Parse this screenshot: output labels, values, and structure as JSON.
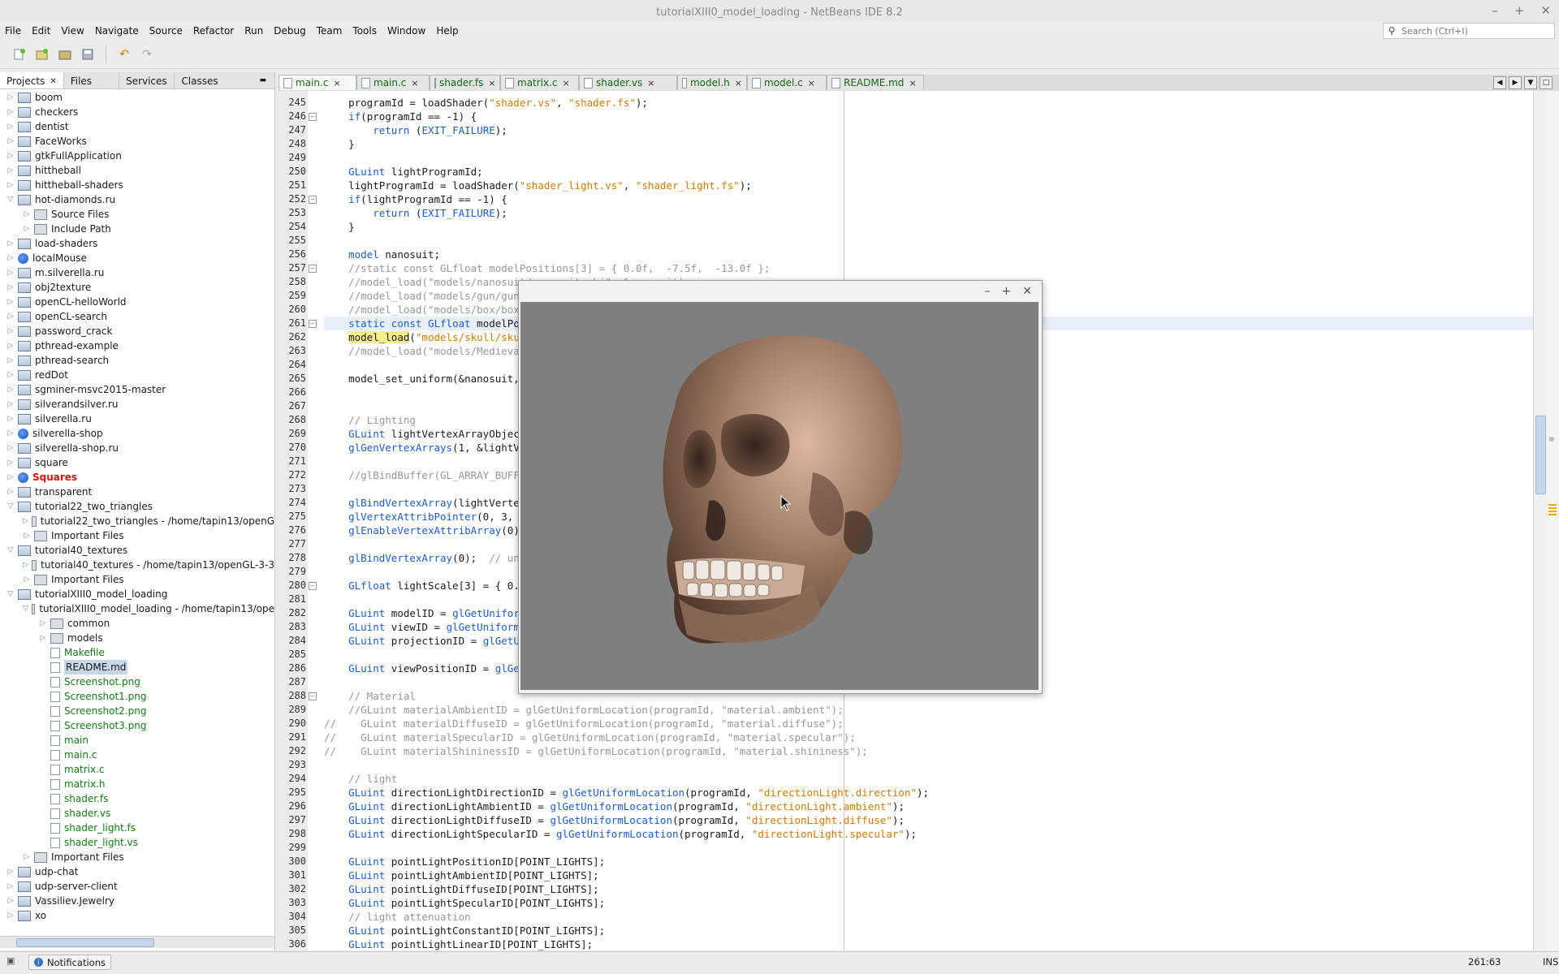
{
  "window": {
    "title": "tutorialXIII0_model_loading - NetBeans IDE 8.2"
  },
  "menu": [
    "File",
    "Edit",
    "View",
    "Navigate",
    "Source",
    "Refactor",
    "Run",
    "Debug",
    "Team",
    "Tools",
    "Window",
    "Help"
  ],
  "search": {
    "placeholder": "Search (Ctrl+I)"
  },
  "left_tabs": [
    "Projects",
    "Files",
    "Services",
    "Classes"
  ],
  "tree": [
    {
      "label": "boom",
      "level": 0,
      "icon": "proj",
      "exp": "+"
    },
    {
      "label": "checkers",
      "level": 0,
      "icon": "proj",
      "exp": "+"
    },
    {
      "label": "dentist",
      "level": 0,
      "icon": "proj",
      "exp": "+"
    },
    {
      "label": "FaceWorks",
      "level": 0,
      "icon": "proj",
      "exp": "+"
    },
    {
      "label": "gtkFullApplication",
      "level": 0,
      "icon": "proj",
      "exp": "+"
    },
    {
      "label": "hittheball",
      "level": 0,
      "icon": "proj",
      "exp": "+"
    },
    {
      "label": "hittheball-shaders",
      "level": 0,
      "icon": "proj",
      "exp": "+"
    },
    {
      "label": "hot-diamonds.ru",
      "level": 0,
      "icon": "proj",
      "exp": "-"
    },
    {
      "label": "Source Files",
      "level": 1,
      "icon": "folder",
      "exp": "+"
    },
    {
      "label": "Include Path",
      "level": 1,
      "icon": "folder",
      "exp": "+"
    },
    {
      "label": "load-shaders",
      "level": 0,
      "icon": "proj",
      "exp": "+"
    },
    {
      "label": "localMouse",
      "level": 0,
      "icon": "globe",
      "exp": "+"
    },
    {
      "label": "m.silverella.ru",
      "level": 0,
      "icon": "proj",
      "exp": "+"
    },
    {
      "label": "obj2texture",
      "level": 0,
      "icon": "proj",
      "exp": "+"
    },
    {
      "label": "openCL-helloWorld",
      "level": 0,
      "icon": "proj",
      "exp": "+"
    },
    {
      "label": "openCL-search",
      "level": 0,
      "icon": "proj",
      "exp": "+"
    },
    {
      "label": "password_crack",
      "level": 0,
      "icon": "proj",
      "exp": "+"
    },
    {
      "label": "pthread-example",
      "level": 0,
      "icon": "proj",
      "exp": "+"
    },
    {
      "label": "pthread-search",
      "level": 0,
      "icon": "proj",
      "exp": "+"
    },
    {
      "label": "redDot",
      "level": 0,
      "icon": "proj",
      "exp": "+"
    },
    {
      "label": "sgminer-msvc2015-master",
      "level": 0,
      "icon": "proj",
      "exp": "+"
    },
    {
      "label": "silverandsilver.ru",
      "level": 0,
      "icon": "proj",
      "exp": "+"
    },
    {
      "label": "silverella.ru",
      "level": 0,
      "icon": "proj",
      "exp": "+"
    },
    {
      "label": "silverella-shop",
      "level": 0,
      "icon": "globe",
      "exp": "+"
    },
    {
      "label": "silverella-shop.ru",
      "level": 0,
      "icon": "proj",
      "exp": "+"
    },
    {
      "label": "square",
      "level": 0,
      "icon": "proj",
      "exp": "+"
    },
    {
      "label": "Squares",
      "level": 0,
      "icon": "globe",
      "exp": "+",
      "style": "red"
    },
    {
      "label": "transparent",
      "level": 0,
      "icon": "proj",
      "exp": "+"
    },
    {
      "label": "tutorial22_two_triangles",
      "level": 0,
      "icon": "proj",
      "exp": "-"
    },
    {
      "label": "tutorial22_two_triangles - /home/tapin13/openG",
      "level": 1,
      "icon": "folder",
      "exp": "+"
    },
    {
      "label": "Important Files",
      "level": 1,
      "icon": "folder",
      "exp": "+"
    },
    {
      "label": "tutorial40_textures",
      "level": 0,
      "icon": "proj",
      "exp": "-"
    },
    {
      "label": "tutorial40_textures - /home/tapin13/openGL-3-3",
      "level": 1,
      "icon": "folder",
      "exp": "+"
    },
    {
      "label": "Important Files",
      "level": 1,
      "icon": "folder",
      "exp": "+"
    },
    {
      "label": "tutorialXIII0_model_loading",
      "level": 0,
      "icon": "proj",
      "exp": "-"
    },
    {
      "label": "tutorialXIII0_model_loading - /home/tapin13/ope",
      "level": 1,
      "icon": "folder",
      "exp": "-"
    },
    {
      "label": "common",
      "level": 2,
      "icon": "folder",
      "exp": "+"
    },
    {
      "label": "models",
      "level": 2,
      "icon": "folder",
      "exp": "+"
    },
    {
      "label": "Makefile",
      "level": 2,
      "icon": "file",
      "exp": "",
      "style": "green"
    },
    {
      "label": "README.md",
      "level": 2,
      "icon": "file",
      "exp": "",
      "style": "sel"
    },
    {
      "label": "Screenshot.png",
      "level": 2,
      "icon": "file",
      "exp": "",
      "style": "green"
    },
    {
      "label": "Screenshot1.png",
      "level": 2,
      "icon": "file",
      "exp": "",
      "style": "green"
    },
    {
      "label": "Screenshot2.png",
      "level": 2,
      "icon": "file",
      "exp": "",
      "style": "green"
    },
    {
      "label": "Screenshot3.png",
      "level": 2,
      "icon": "file",
      "exp": "",
      "style": "green"
    },
    {
      "label": "main",
      "level": 2,
      "icon": "file",
      "exp": "",
      "style": "green"
    },
    {
      "label": "main.c",
      "level": 2,
      "icon": "file",
      "exp": "",
      "style": "green"
    },
    {
      "label": "matrix.c",
      "level": 2,
      "icon": "file",
      "exp": "",
      "style": "green"
    },
    {
      "label": "matrix.h",
      "level": 2,
      "icon": "file",
      "exp": "",
      "style": "green"
    },
    {
      "label": "shader.fs",
      "level": 2,
      "icon": "file",
      "exp": "",
      "style": "green"
    },
    {
      "label": "shader.vs",
      "level": 2,
      "icon": "file",
      "exp": "",
      "style": "green"
    },
    {
      "label": "shader_light.fs",
      "level": 2,
      "icon": "file",
      "exp": "",
      "style": "green"
    },
    {
      "label": "shader_light.vs",
      "level": 2,
      "icon": "file",
      "exp": "",
      "style": "green"
    },
    {
      "label": "Important Files",
      "level": 1,
      "icon": "folder",
      "exp": "+"
    },
    {
      "label": "udp-chat",
      "level": 0,
      "icon": "proj",
      "exp": "+"
    },
    {
      "label": "udp-server-client",
      "level": 0,
      "icon": "proj",
      "exp": "+"
    },
    {
      "label": "Vassiliev.Jewelry",
      "level": 0,
      "icon": "proj",
      "exp": "+"
    },
    {
      "label": "xo",
      "level": 0,
      "icon": "proj",
      "exp": "+"
    }
  ],
  "editor_tabs": [
    "main.c",
    "main.c",
    "shader.fs",
    "matrix.c",
    "shader.vs",
    "model.h",
    "model.c",
    "README.md"
  ],
  "code": [
    {
      "n": "245",
      "h": "    programId = loadShader(<s>\"shader.vs\"</s>, <s>\"shader.fs\"</s>);"
    },
    {
      "n": "246",
      "f": "-",
      "h": "    <k>if</k>(programId == -1) {"
    },
    {
      "n": "247",
      "h": "        <k>return</k> (<c>EXIT_FAILURE</c>);"
    },
    {
      "n": "248",
      "h": "    }"
    },
    {
      "n": "249",
      "h": ""
    },
    {
      "n": "250",
      "h": "    <t>GLuint</t> lightProgramId;"
    },
    {
      "n": "251",
      "h": "    lightProgramId = loadShader(<s>\"shader_light.vs\"</s>, <s>\"shader_light.fs\"</s>);"
    },
    {
      "n": "252",
      "f": "-",
      "h": "    <k>if</k>(lightProgramId == -1) {"
    },
    {
      "n": "253",
      "h": "        <k>return</k> (<c>EXIT_FAILURE</c>);"
    },
    {
      "n": "254",
      "h": "    }"
    },
    {
      "n": "255",
      "h": ""
    },
    {
      "n": "256",
      "h": "    <t>model</t> nanosuit;"
    },
    {
      "n": "257",
      "f": "-",
      "h": "    <m>//static const GLfloat modelPositions[3] = { 0.0f,  -7.5f,  -13.0f };</m>"
    },
    {
      "n": "258",
      "h": "    <m>//model_load(\"models/nanosuit/nanosuit.obj\", &nanosuit);</m>"
    },
    {
      "n": "259",
      "h": "    <m>//model_load(\"models/gun/gun.obj\", &nanosuit);</m>"
    },
    {
      "n": "260",
      "h": "    <m>//model_load(\"models/box/box.obj\", &nanosuit);</m>"
    },
    {
      "n": "261",
      "f": "-",
      "hl": true,
      "h": "    <k>static</k> <k>const</k> <t>GLfloat</t> modelPositions[3] = { 0.0f,  -7.5f,  -13.0f };"
    },
    {
      "n": "262",
      "h": "    <y>model_load</y>(<s>\"models/skull/skull.obj\"</s>, &nanosuit);"
    },
    {
      "n": "263",
      "h": "    <m>//model_load(\"models/Medieval/Medieval.obj\", &nanosuit);</m>"
    },
    {
      "n": "264",
      "h": ""
    },
    {
      "n": "265",
      "h": "    model_set_uniform(&nanosuit, programId);"
    },
    {
      "n": "266",
      "h": ""
    },
    {
      "n": "267",
      "h": ""
    },
    {
      "n": "268",
      "h": "    <m>// Lighting</m>"
    },
    {
      "n": "269",
      "h": "    <t>GLuint</t> lightVertexArrayObject;"
    },
    {
      "n": "270",
      "h": "    <f>glGenVertexArrays</f>(1, &lightVertexArrayObject);"
    },
    {
      "n": "271",
      "h": ""
    },
    {
      "n": "272",
      "h": "    <m>//glBindBuffer(GL_ARRAY_BUFFER, vertexBufferObject);</m>"
    },
    {
      "n": "273",
      "h": ""
    },
    {
      "n": "274",
      "h": "    <f>glBindVertexArray</f>(lightVertexArrayObject);"
    },
    {
      "n": "275",
      "h": "    <f>glVertexAttribPointer</f>(0, 3, GL_FLOAT, GL_FALSE, 0, 0);"
    },
    {
      "n": "276",
      "h": "    <f>glEnableVertexAttribArray</f>(0);"
    },
    {
      "n": "277",
      "h": ""
    },
    {
      "n": "278",
      "h": "    <f>glBindVertexArray</f>(0);  <m>// unbind</m>"
    },
    {
      "n": "279",
      "h": ""
    },
    {
      "n": "280",
      "f": "-",
      "h": "    <t>GLfloat</t> lightScale[3] = { 0.2f, 0.2f, 0.2f };"
    },
    {
      "n": "281",
      "h": ""
    },
    {
      "n": "282",
      "h": "    <t>GLuint</t> modelID = <f>glGetUniformLocation</f>(programId, <s>\"model\"</s>);"
    },
    {
      "n": "283",
      "h": "    <t>GLuint</t> viewID = <f>glGetUniformLocation</f>(programId, <s>\"view\"</s>);"
    },
    {
      "n": "284",
      "h": "    <t>GLuint</t> projectionID = <f>glGetUniformLocation</f>(programId, <s>\"projection\"</s>);"
    },
    {
      "n": "285",
      "h": ""
    },
    {
      "n": "286",
      "h": "    <t>GLuint</t> viewPositionID = <f>glGetUniformLocation</f>(programId, <s>\"viewPosition\"</s>);"
    },
    {
      "n": "287",
      "h": ""
    },
    {
      "n": "288",
      "f": "-",
      "h": "    <m>// Material</m>"
    },
    {
      "n": "289",
      "h": "    <m>//GLuint materialAmbientID = glGetUniformLocation(programId, \"material.ambient\");</m>"
    },
    {
      "n": "290",
      "h": "<m>//    GLuint materialDiffuseID = glGetUniformLocation(programId, \"material.diffuse\");</m>"
    },
    {
      "n": "291",
      "h": "<m>//    GLuint materialSpecularID = glGetUniformLocation(programId, \"material.specular\");</m>"
    },
    {
      "n": "292",
      "h": "<m>//    GLuint materialShininessID = glGetUniformLocation(programId, \"material.shininess\");</m>"
    },
    {
      "n": "293",
      "h": ""
    },
    {
      "n": "294",
      "h": "    <m>// light</m>"
    },
    {
      "n": "295",
      "h": "    <t>GLuint</t> directionLightDirectionID = <f>glGetUniformLocation</f>(programId, <s>\"directionLight.direction\"</s>);"
    },
    {
      "n": "296",
      "h": "    <t>GLuint</t> directionLightAmbientID = <f>glGetUniformLocation</f>(programId, <s>\"directionLight.ambient\"</s>);"
    },
    {
      "n": "297",
      "h": "    <t>GLuint</t> directionLightDiffuseID = <f>glGetUniformLocation</f>(programId, <s>\"directionLight.diffuse\"</s>);"
    },
    {
      "n": "298",
      "h": "    <t>GLuint</t> directionLightSpecularID = <f>glGetUniformLocation</f>(programId, <s>\"directionLight.specular\"</s>);"
    },
    {
      "n": "299",
      "h": ""
    },
    {
      "n": "300",
      "h": "    <t>GLuint</t> pointLightPositionID[POINT_LIGHTS];"
    },
    {
      "n": "301",
      "h": "    <t>GLuint</t> pointLightAmbientID[POINT_LIGHTS];"
    },
    {
      "n": "302",
      "h": "    <t>GLuint</t> pointLightDiffuseID[POINT_LIGHTS];"
    },
    {
      "n": "303",
      "h": "    <t>GLuint</t> pointLightSpecularID[POINT_LIGHTS];"
    },
    {
      "n": "304",
      "h": "    <m>// light attenuation</m>"
    },
    {
      "n": "305",
      "h": "    <t>GLuint</t> pointLightConstantID[POINT_LIGHTS];"
    },
    {
      "n": "306",
      "h": "    <t>GLuint</t> pointLightLinearID[POINT_LIGHTS];"
    }
  ],
  "status": {
    "notifications": "Notifications",
    "position": "261:63",
    "mode": "INS"
  },
  "colors": {
    "keyword": "#1a5dc4",
    "string": "#ce7b00",
    "comment": "#969696",
    "green_file": "#127a12",
    "red_project": "#e01010"
  }
}
